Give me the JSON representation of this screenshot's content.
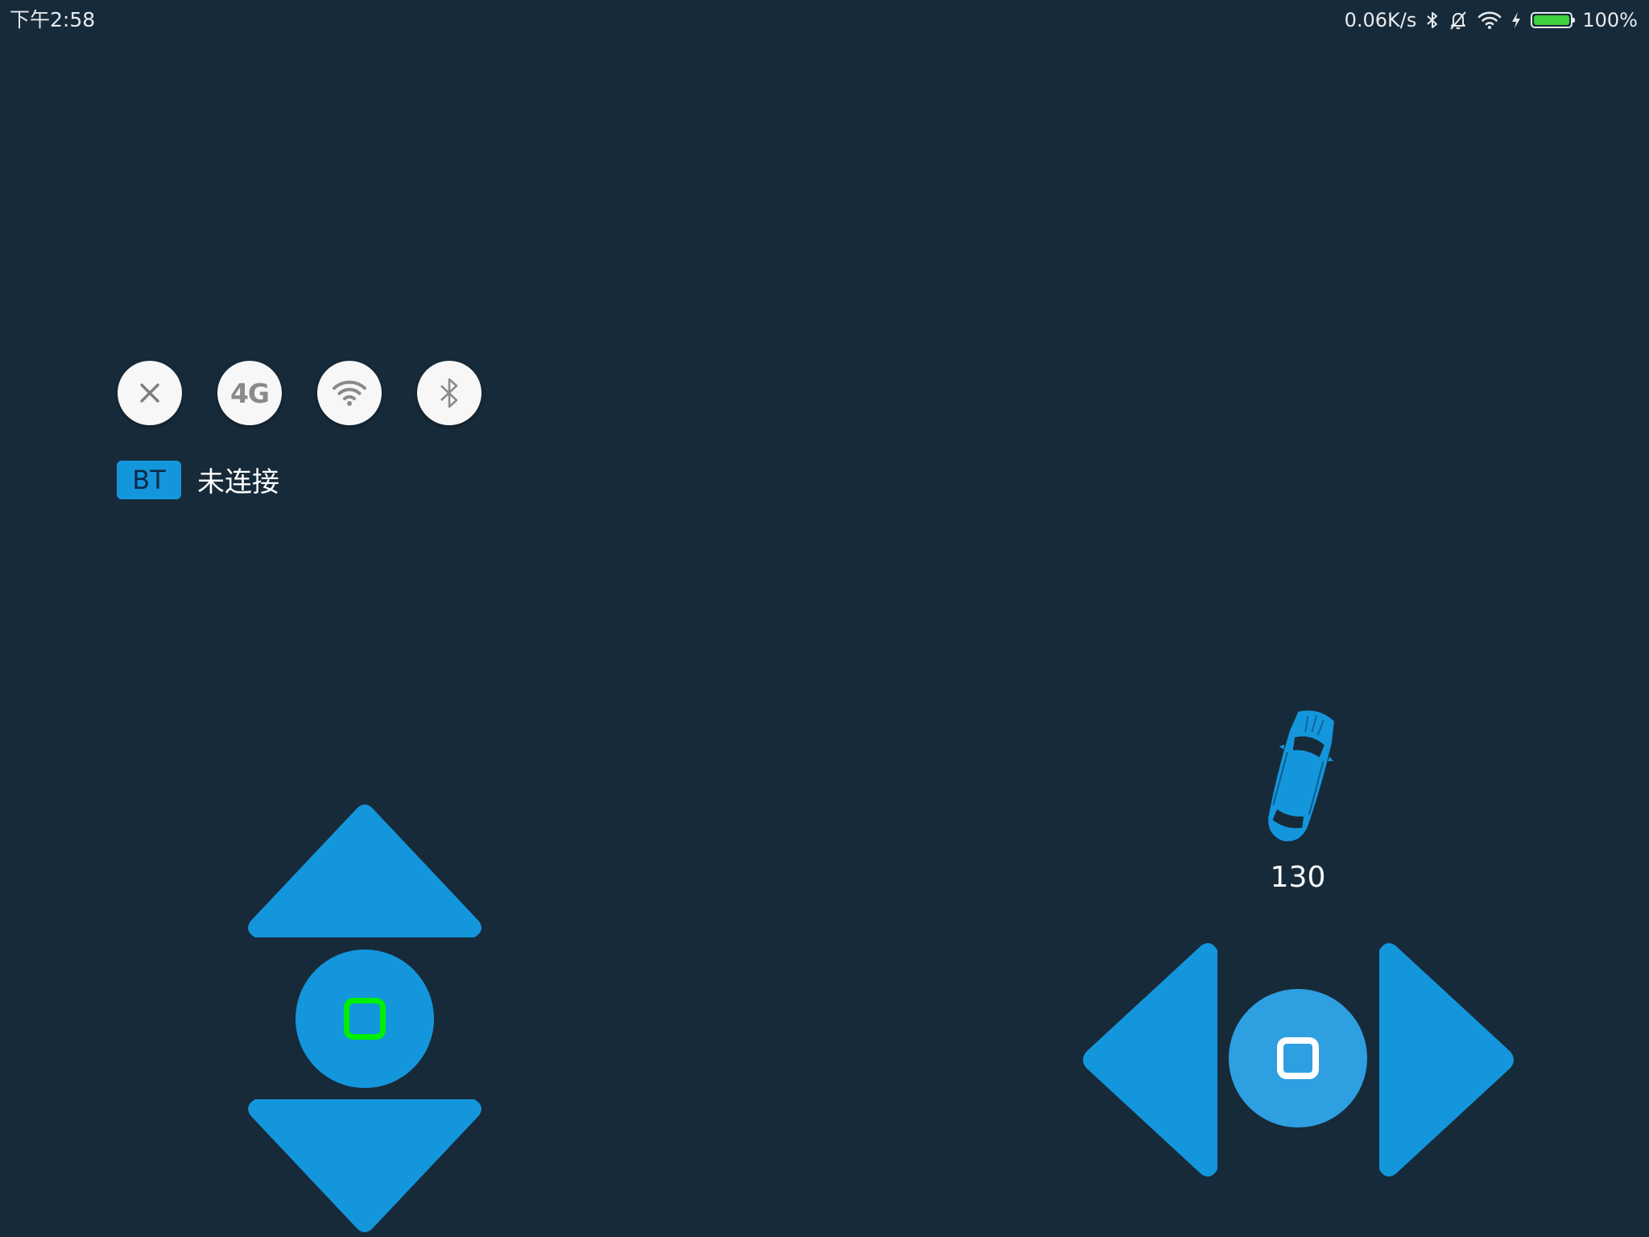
{
  "status_bar": {
    "time": "下午2:58",
    "network_speed": "0.06K/s",
    "battery_percent": "100%",
    "battery_level": 1.0,
    "icons": [
      "bluetooth-icon",
      "bell-off-icon",
      "wifi-icon",
      "charging-icon",
      "battery-icon"
    ]
  },
  "mode_buttons": {
    "disconnect_icon": "close-icon",
    "cellular_label": "4G",
    "wifi_icon": "wifi-icon",
    "bluetooth_icon": "bluetooth-icon"
  },
  "connection": {
    "badge": "BT",
    "status": "未连接"
  },
  "throttle": {
    "up_icon": "up-arrow-icon",
    "stop_icon": "stop-icon",
    "down_icon": "down-arrow-icon"
  },
  "steering": {
    "left_icon": "left-arrow-icon",
    "center_icon": "stop-icon",
    "right_icon": "right-arrow-icon",
    "car_icon": "car-icon",
    "angle_value": "130"
  },
  "colors": {
    "background": "#172a39",
    "accent": "#1496dc",
    "active_indicator": "#00f000",
    "button_face": "#f7f7f7",
    "icon_gray": "#8a8a8a"
  }
}
